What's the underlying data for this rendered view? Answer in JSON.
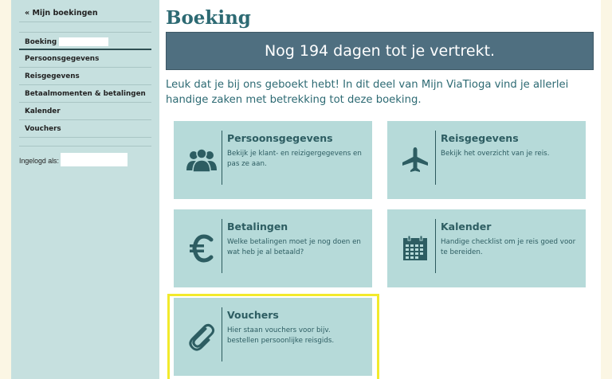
{
  "sidebar": {
    "back_link": "« Mijn boekingen",
    "items": [
      {
        "label": "Boeking"
      },
      {
        "label": "Persoonsgegevens"
      },
      {
        "label": "Reisgegevens"
      },
      {
        "label": "Betaalmomenten & betalingen"
      },
      {
        "label": "Kalender"
      },
      {
        "label": "Vouchers"
      }
    ],
    "login_label": "Ingelogd als:"
  },
  "main": {
    "title": "Boeking",
    "countdown": "Nog 194 dagen tot je vertrekt.",
    "intro": "Leuk dat je bij ons geboekt hebt! In dit deel van Mijn ViaTioga vind je allerlei handige zaken met betrekking tot deze boeking.",
    "cards": [
      {
        "title": "Persoonsgegevens",
        "desc": "Bekijk je klant- en reizigergegevens en pas ze aan.",
        "icon": "users-icon"
      },
      {
        "title": "Reisgegevens",
        "desc": "Bekijk het overzicht van je reis.",
        "icon": "airplane-icon"
      },
      {
        "title": "Betalingen",
        "desc": "Welke betalingen moet je nog doen en wat heb je al betaald?",
        "icon": "euro-icon"
      },
      {
        "title": "Kalender",
        "desc": "Handige checklist om je reis goed voor te bereiden.",
        "icon": "calendar-icon"
      },
      {
        "title": "Vouchers",
        "desc": "Hier staan vouchers voor bijv. bestellen persoonlijke reisgids.",
        "icon": "paperclip-icon"
      }
    ]
  },
  "colors": {
    "accent": "#2d6a73",
    "banner": "#4f6f80",
    "card": "#b6dad9",
    "sidebar": "#c6e0df",
    "highlight": "#f2ea2c"
  }
}
